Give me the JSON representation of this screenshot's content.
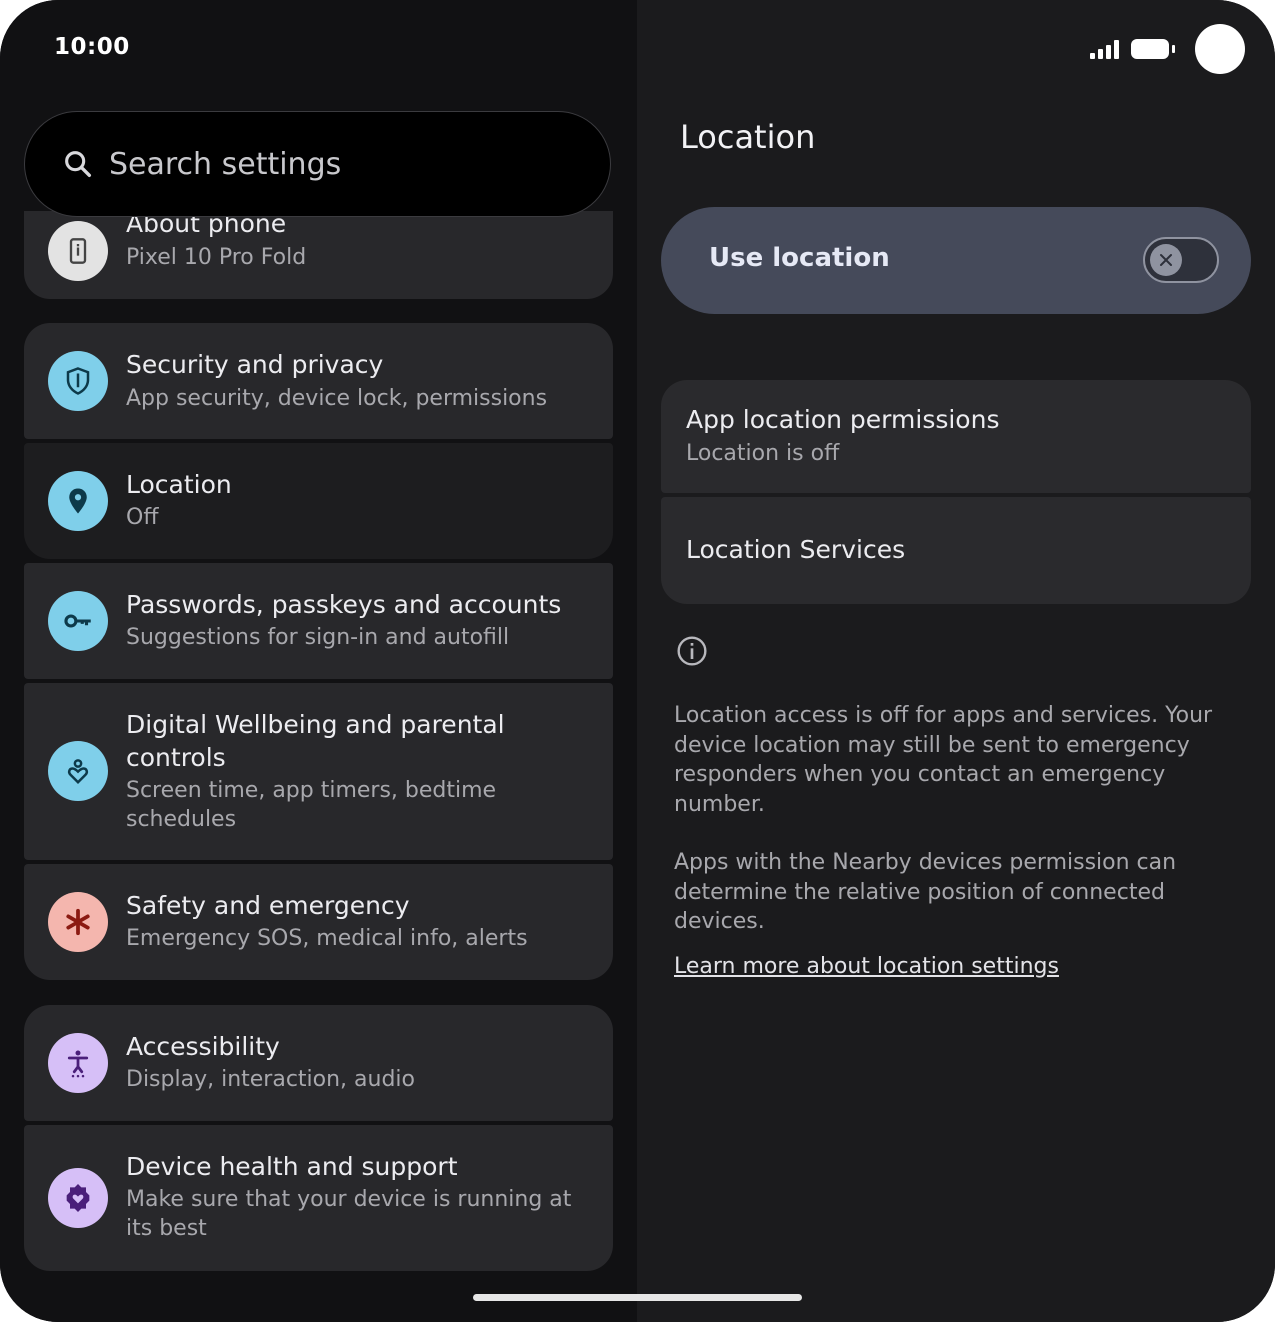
{
  "status": {
    "time": "10:00"
  },
  "search": {
    "placeholder": "Search settings"
  },
  "settings_list": [
    {
      "title": "About phone",
      "subtitle": "Pixel 10 Pro Fold",
      "icon": "info-phone-icon",
      "icon_bg": "#e3e3e3"
    },
    {
      "title": "Security and privacy",
      "subtitle": "App security, device lock, permissions",
      "icon": "shield-icon",
      "icon_bg": "#7fcfea"
    },
    {
      "title": "Location",
      "subtitle": "Off",
      "icon": "location-pin-icon",
      "icon_bg": "#7fcfea"
    },
    {
      "title": "Passwords, passkeys and accounts",
      "subtitle": "Suggestions for sign-in and autofill",
      "icon": "key-icon",
      "icon_bg": "#7fcfea"
    },
    {
      "title": "Digital Wellbeing and parental controls",
      "subtitle": "Screen time, app timers, bedtime schedules",
      "icon": "wellbeing-icon",
      "icon_bg": "#7fcfea"
    },
    {
      "title": "Safety and emergency",
      "subtitle": "Emergency SOS, medical info, alerts",
      "icon": "asterisk-icon",
      "icon_bg": "#f4b6ae"
    },
    {
      "title": "Accessibility",
      "subtitle": "Display, interaction, audio",
      "icon": "accessibility-icon",
      "icon_bg": "#d6bff7"
    },
    {
      "title": "Device health and support",
      "subtitle": "Make sure that your device is running at its best",
      "icon": "device-health-icon",
      "icon_bg": "#d6bff7"
    }
  ],
  "detail": {
    "title": "Location",
    "use_location_label": "Use location",
    "use_location_on": false,
    "app_permissions_title": "App location permissions",
    "app_permissions_sub": "Location is off",
    "location_services": "Location Services",
    "info_text_1": "Location access is off for apps and services. Your device location may still be sent to emergency responders when you contact an emergency number.",
    "info_text_2": "Apps with the Nearby devices permission can determine the relative position of connected devices.",
    "learn_more": "Learn more about location settings"
  }
}
